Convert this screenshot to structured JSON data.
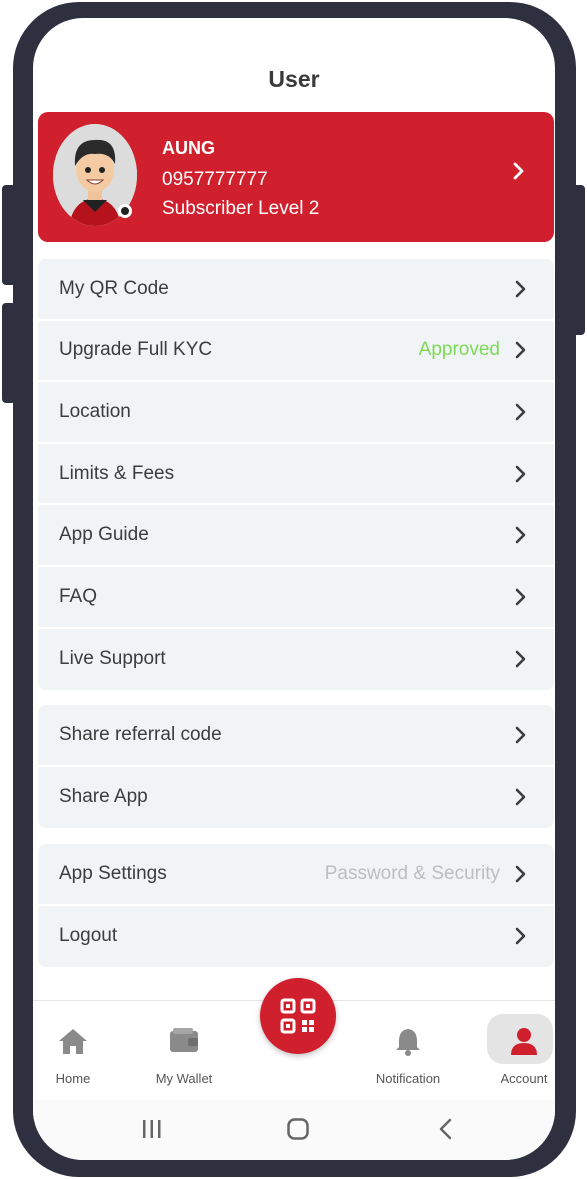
{
  "header": {
    "title": "User"
  },
  "profile": {
    "name": "AUNG",
    "phone": "0957777777",
    "level": "Subscriber Level 2"
  },
  "menu_group_1": [
    {
      "label": "My QR Code",
      "value": ""
    },
    {
      "label": "Upgrade Full KYC",
      "value": "Approved"
    },
    {
      "label": "Location",
      "value": ""
    },
    {
      "label": "Limits & Fees",
      "value": ""
    },
    {
      "label": "App Guide",
      "value": ""
    },
    {
      "label": "FAQ",
      "value": ""
    },
    {
      "label": "Live Support",
      "value": ""
    }
  ],
  "menu_group_2": [
    {
      "label": "Share referral code",
      "value": ""
    },
    {
      "label": "Share App",
      "value": ""
    }
  ],
  "menu_group_3": [
    {
      "label": "App Settings",
      "value": "Password & Security"
    },
    {
      "label": "Logout",
      "value": ""
    }
  ],
  "bottom_nav": {
    "home": "Home",
    "wallet": "My Wallet",
    "notification": "Notification",
    "account": "Account",
    "active": "account"
  },
  "colors": {
    "brand_red": "#d0202e",
    "approved_green": "#7ed957",
    "muted_value": "#bdbdbd",
    "row_bg": "#f1f4f6",
    "phone_frame": "#2e3040"
  }
}
